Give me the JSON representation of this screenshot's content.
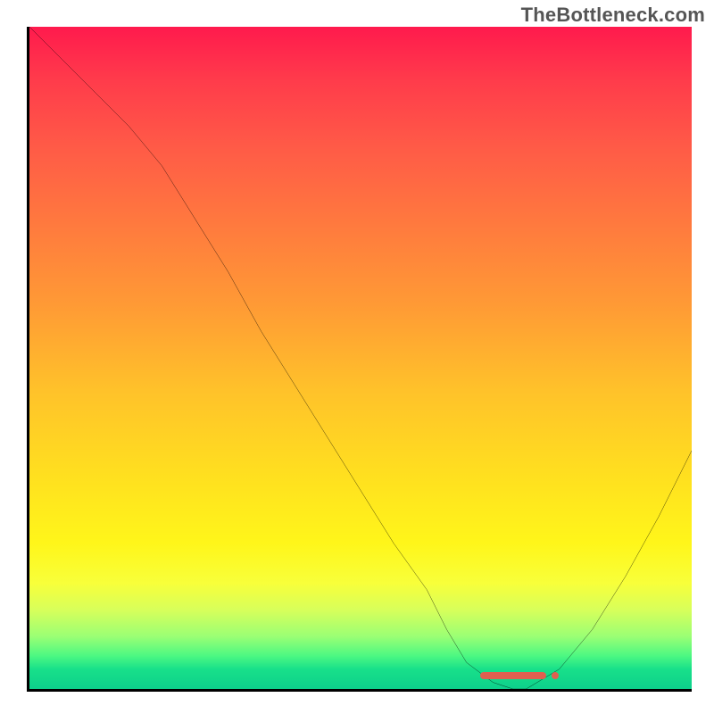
{
  "watermark": "TheBottleneck.com",
  "colors": {
    "axis": "#000000",
    "curve": "#000000",
    "marker": "#e06050",
    "gradient_top": "#ff1a4d",
    "gradient_bottom": "#0dd08b"
  },
  "chart_data": {
    "type": "line",
    "title": "",
    "xlabel": "",
    "ylabel": "",
    "xlim": [
      0,
      100
    ],
    "ylim": [
      0,
      100
    ],
    "grid": false,
    "legend_position": "none",
    "background_gradient": {
      "direction": "vertical",
      "stops": [
        {
          "pos": 0.0,
          "color": "#ff1a4d"
        },
        {
          "pos": 0.3,
          "color": "#ff7a3e"
        },
        {
          "pos": 0.55,
          "color": "#ffc22a"
        },
        {
          "pos": 0.78,
          "color": "#fff61a"
        },
        {
          "pos": 1.0,
          "color": "#0dd08b"
        }
      ]
    },
    "series": [
      {
        "name": "bottleneck-curve",
        "x": [
          0,
          5,
          10,
          15,
          20,
          25,
          30,
          35,
          40,
          45,
          50,
          55,
          60,
          63,
          66,
          70,
          73,
          75,
          80,
          85,
          90,
          95,
          100
        ],
        "y": [
          100,
          95,
          90,
          85,
          79,
          71,
          63,
          54,
          46,
          38,
          30,
          22,
          15,
          9,
          4,
          1,
          0,
          0,
          3,
          9,
          17,
          26,
          36
        ]
      }
    ],
    "marker": {
      "name": "optimal-range",
      "x_center": 73,
      "y": 0,
      "x_width": 10
    }
  }
}
